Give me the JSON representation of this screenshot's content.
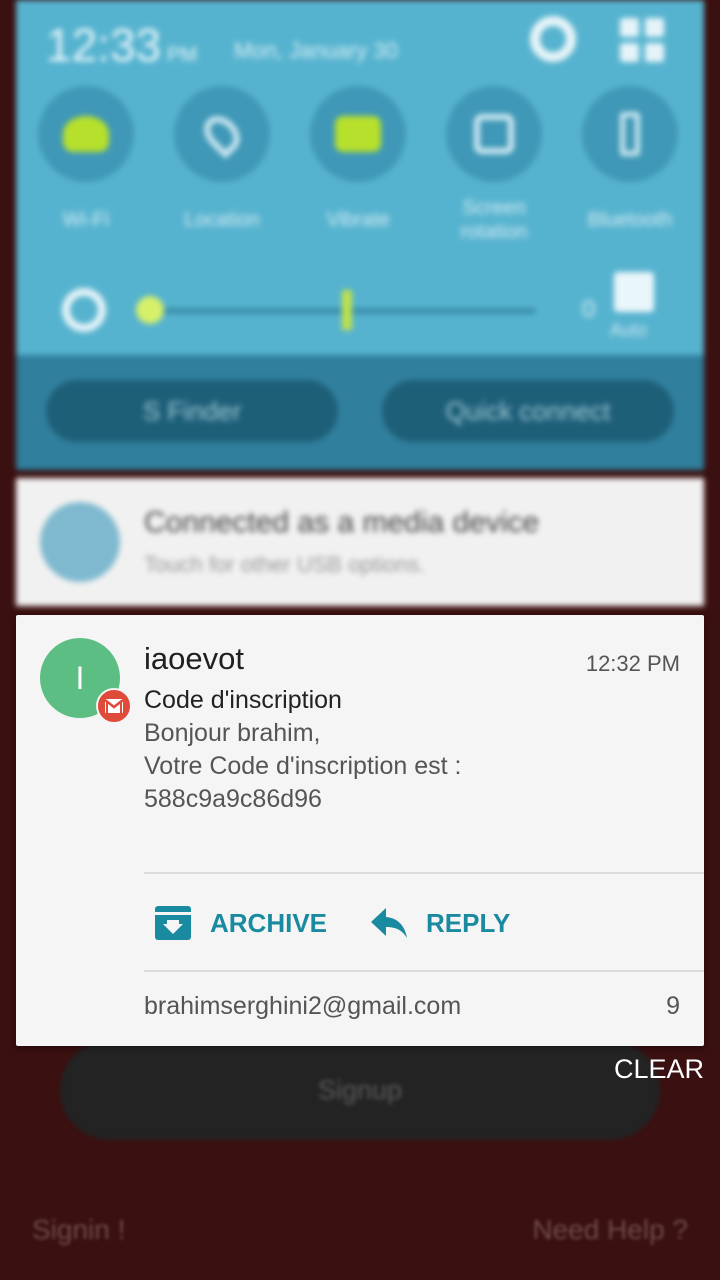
{
  "background_app": {
    "signup_label": "Signup",
    "signin_label": "Signin !",
    "help_label": "Need Help ?"
  },
  "shade": {
    "time": "12:33",
    "ampm": "PM",
    "date": "Mon, January 30",
    "quick_settings": [
      {
        "label": "Wi-Fi",
        "icon": "wifi-icon"
      },
      {
        "label": "Location",
        "icon": "location-icon"
      },
      {
        "label": "Vibrate",
        "icon": "vibrate-icon"
      },
      {
        "label": "Screen rotation",
        "icon": "screen-rotation-icon"
      },
      {
        "label": "Bluetooth",
        "icon": "bluetooth-icon"
      }
    ],
    "brightness_value": "0",
    "auto_label": "Auto",
    "s_finder_label": "S Finder",
    "quick_connect_label": "Quick connect"
  },
  "usb_notification": {
    "title": "Connected as a media device",
    "subtitle": "Touch for other USB options."
  },
  "gmail_notification": {
    "avatar_letter": "I",
    "sender": "iaoevot",
    "time": "12:32 PM",
    "subject": "Code d'inscription",
    "body_lines": [
      "Bonjour brahim,",
      "Votre Code d'inscription est :",
      "588c9a9c86d96"
    ],
    "archive_label": "ARCHIVE",
    "reply_label": "REPLY",
    "account": "brahimserghini2@gmail.com",
    "count": "9",
    "accent_color": "#1a8aa0",
    "avatar_color": "#5cbe83",
    "badge_color": "#df4a3a"
  },
  "clear_label": "CLEAR"
}
